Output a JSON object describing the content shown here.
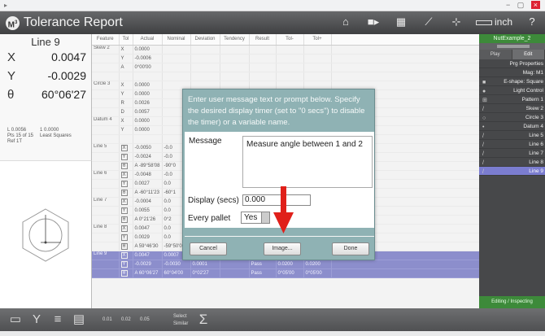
{
  "app": {
    "title": "Tolerance Report",
    "unit_label": "inch",
    "help_label": "?"
  },
  "readout": {
    "feature_name": "Line 9",
    "axes": [
      {
        "label": "X",
        "value": "0.0047"
      },
      {
        "label": "Y",
        "value": "-0.0029"
      },
      {
        "label": "θ",
        "value": "60°06'27"
      }
    ],
    "small_line1_a": "L   0.0056",
    "small_line1_b": "1   0.0000",
    "small_line2_a": "Pts 15 of 15",
    "small_line2_b": "Least Squares",
    "small_line3": "Ref 1T"
  },
  "table": {
    "headers": [
      "Feature",
      "Tol",
      "Actual",
      "Nominal",
      "Deviation",
      "Tendency",
      "Result",
      "Tol-",
      "Tol+"
    ],
    "rows": [
      {
        "feature": "Skew 2",
        "axis": "X",
        "actual": "0.0000"
      },
      {
        "feature": "",
        "axis": "Y",
        "actual": "-0.0006"
      },
      {
        "feature": "",
        "axis": "A",
        "actual": "0°00'00"
      },
      {
        "feature": "",
        "axis": "",
        "actual": ""
      },
      {
        "feature": "Circle 3",
        "axis": "X",
        "actual": "0.0000"
      },
      {
        "feature": "",
        "axis": "Y",
        "actual": "0.0000"
      },
      {
        "feature": "",
        "axis": "R",
        "actual": "0.0026"
      },
      {
        "feature": "",
        "axis": "D",
        "actual": "0.0057"
      },
      {
        "feature": "Datum 4",
        "axis": "X",
        "actual": "0.0000"
      },
      {
        "feature": "",
        "axis": "Y",
        "actual": "0.0000"
      },
      {
        "feature": "",
        "axis": "",
        "actual": ""
      },
      {
        "feature": "Line 5",
        "axis": "X",
        "actual": "-0.0050",
        "nominal": "-0.0",
        "box": true
      },
      {
        "feature": "",
        "axis": "Y",
        "actual": "-0.0024",
        "nominal": "-0.0",
        "box": true
      },
      {
        "feature": "",
        "axis": "θ",
        "actual": "A -89°58'08",
        "nominal": "-90°0",
        "box": true
      },
      {
        "feature": "Line 6",
        "axis": "X",
        "actual": "-0.0048",
        "nominal": "-0.0",
        "box": true
      },
      {
        "feature": "",
        "axis": "Y",
        "actual": "0.0027",
        "nominal": "0.0",
        "box": true
      },
      {
        "feature": "",
        "axis": "θ",
        "actual": "A -60°11'23",
        "nominal": "-60°1",
        "box": true
      },
      {
        "feature": "Line 7",
        "axis": "X",
        "actual": "-0.0004",
        "nominal": "0.0",
        "box": true
      },
      {
        "feature": "",
        "axis": "Y",
        "actual": "0.0055",
        "nominal": "0.0",
        "box": true
      },
      {
        "feature": "",
        "axis": "θ",
        "actual": "A 0°21'26",
        "nominal": "0°2",
        "box": true
      },
      {
        "feature": "Line 8",
        "axis": "X",
        "actual": "0.0047",
        "nominal": "0.0",
        "box": true
      },
      {
        "feature": "",
        "axis": "Y",
        "actual": "0.0029",
        "nominal": "0.0",
        "box": true
      },
      {
        "feature": "",
        "axis": "θ",
        "actual": "A 59°46'30",
        "nominal": "-59°50'00",
        "deviation": "0°03'30",
        "result": "Pass",
        "tolm": "0°04'00",
        "tolp": "0°04'00",
        "box": true
      },
      {
        "feature": "Line 9",
        "axis": "X",
        "actual": "0.0047",
        "nominal": "0.0007",
        "deviation": "0.0003",
        "result": "Pass",
        "tolm": "0.0200",
        "tolp": "0.0200",
        "box": true,
        "sel": true
      },
      {
        "feature": "",
        "axis": "Y",
        "actual": "-0.0029",
        "nominal": "-0.0030",
        "deviation": "0.0001",
        "result": "Pass",
        "tolm": "0.0200",
        "tolp": "0.0200",
        "box": true,
        "sel": true
      },
      {
        "feature": "",
        "axis": "θ",
        "actual": "A 60°06'27",
        "nominal": "60°04'00",
        "deviation": "0°02'27",
        "result": "Pass",
        "tolm": "0°05'00",
        "tolp": "0°05'00",
        "box": true,
        "sel": true
      }
    ]
  },
  "dialog": {
    "prompt": "Enter user message text or prompt below. Specify the desired display timer (set to \"0 secs\") to disable the timer) or a variable name.",
    "message_label": "Message",
    "message_value": "Measure angle between 1 and 2",
    "display_label": "Display (secs)",
    "display_value": "0.000",
    "pallet_label": "Every pallet",
    "pallet_value": "Yes",
    "cancel_label": "Cancel",
    "image_label": "Image...",
    "done_label": "Done"
  },
  "right_panel": {
    "part_name": "NutExample_2",
    "tab_play": "Play",
    "tab_edit": "Edit",
    "items": [
      {
        "label": "Prg Properties",
        "icon": ""
      },
      {
        "label": "Mag: M1",
        "icon": ""
      },
      {
        "label": "E-shape: Square",
        "icon": "■"
      },
      {
        "label": "Light Control",
        "icon": "●"
      },
      {
        "label": "Pattern 1",
        "icon": "⊞"
      },
      {
        "label": "Skew 2",
        "icon": "/"
      },
      {
        "label": "Circle 3",
        "icon": "○"
      },
      {
        "label": "Datum 4",
        "icon": "•"
      },
      {
        "label": "Line 5",
        "icon": "/"
      },
      {
        "label": "Line 6",
        "icon": "/"
      },
      {
        "label": "Line 7",
        "icon": "/"
      },
      {
        "label": "Line 8",
        "icon": "/"
      },
      {
        "label": "Line 9",
        "icon": "/"
      }
    ],
    "status": "Editing / Inspecting"
  },
  "bottom": {
    "v1": "0.01",
    "v2": "0.02",
    "v3": "0.05",
    "select_label": "Select",
    "similar_label": "Similar",
    "sigma": "Σ"
  },
  "colors": {
    "selected_row": "#8c8ecc",
    "dialog_bg": "#8fb2b4",
    "arrow": "#e0201a",
    "part_green": "#3d8a3a"
  }
}
